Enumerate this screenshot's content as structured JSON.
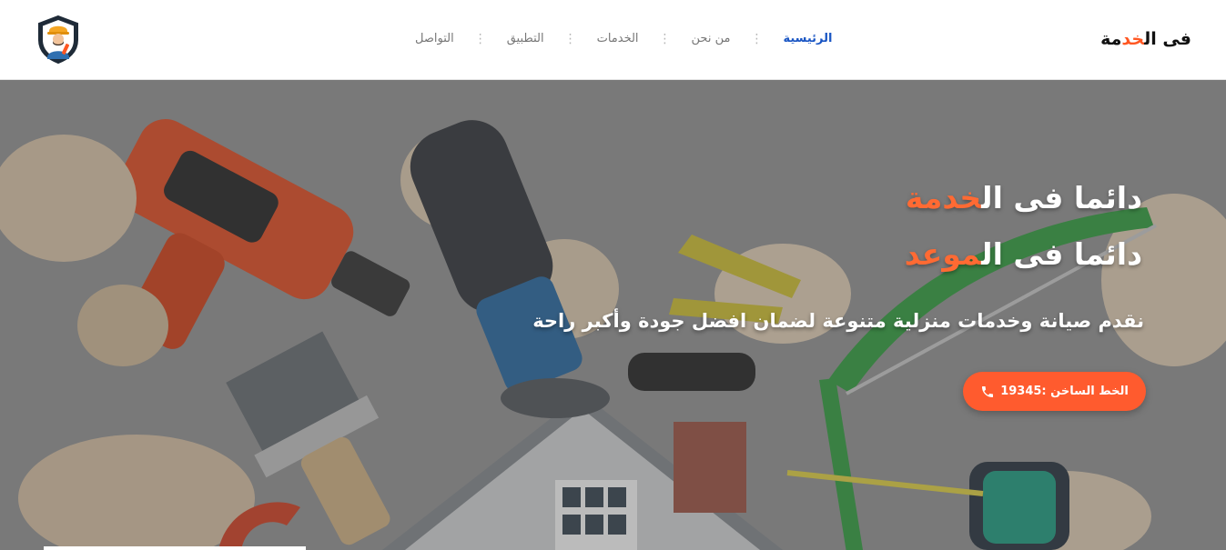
{
  "brand": {
    "part1": "فى ال",
    "part2": "خد",
    "part3": "مة"
  },
  "nav": {
    "items": [
      {
        "label": "الرئيسية",
        "active": true
      },
      {
        "label": "من نحن",
        "active": false
      },
      {
        "label": "الخدمات",
        "active": false
      },
      {
        "label": "التطبيق",
        "active": false
      },
      {
        "label": "التواصل",
        "active": false
      }
    ],
    "separator": "⋮"
  },
  "hero": {
    "line1": {
      "before": "دائما فى ال",
      "accent": "خدمة"
    },
    "line2": {
      "before": "دائما فى ال",
      "accent": "موعد"
    },
    "subtitle": "نقدم صيانة وخدمات منزلية متنوعة لضمان افضل جودة وأكبر راحة",
    "hotline_label": "الخط الساخن :19345"
  },
  "icons": {
    "logo": "worker-shield-logo-icon",
    "phone": "phone-icon"
  },
  "colors": {
    "accent": "#ff5722",
    "nav_active": "#1a56c4",
    "button": "#ff5b2e"
  }
}
